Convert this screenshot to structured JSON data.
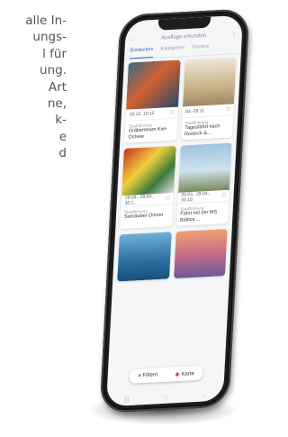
{
  "background_text": {
    "lines": [
      "alle In-",
      "ungs-",
      "l  für",
      "ung.",
      "Art",
      "ne,",
      "k-",
      "e",
      "d"
    ]
  },
  "app": {
    "title": "Ausflüge erkunden",
    "tabs": [
      "Entdecken",
      "Kategorien",
      "Termine"
    ]
  },
  "cards": [
    {
      "date": "20.12. 10:15",
      "category": "Stadtführung",
      "title": "Gräbenteam Kiel-Ostsee"
    },
    {
      "date": "04.-28.11",
      "category": "Stadtführung",
      "title": "Tagesfahrt nach Rostock &..."
    },
    {
      "date": "28.03., 29.04., 30.1...",
      "category": "Stadtführung",
      "title": "Seeräuber-Dinner"
    },
    {
      "date": "20.03., 29.04., 30.10.",
      "category": "Stadtführung",
      "title": "Fahrt mit der MS Baltica ..."
    },
    {
      "date": "",
      "category": "",
      "title": ""
    },
    {
      "date": "",
      "category": "",
      "title": ""
    }
  ],
  "bottombar": {
    "filter_label": "Filtern",
    "map_label": "Karte"
  },
  "colors": {
    "accent": "#3b6fb6",
    "frame": "#1e1e1e"
  }
}
